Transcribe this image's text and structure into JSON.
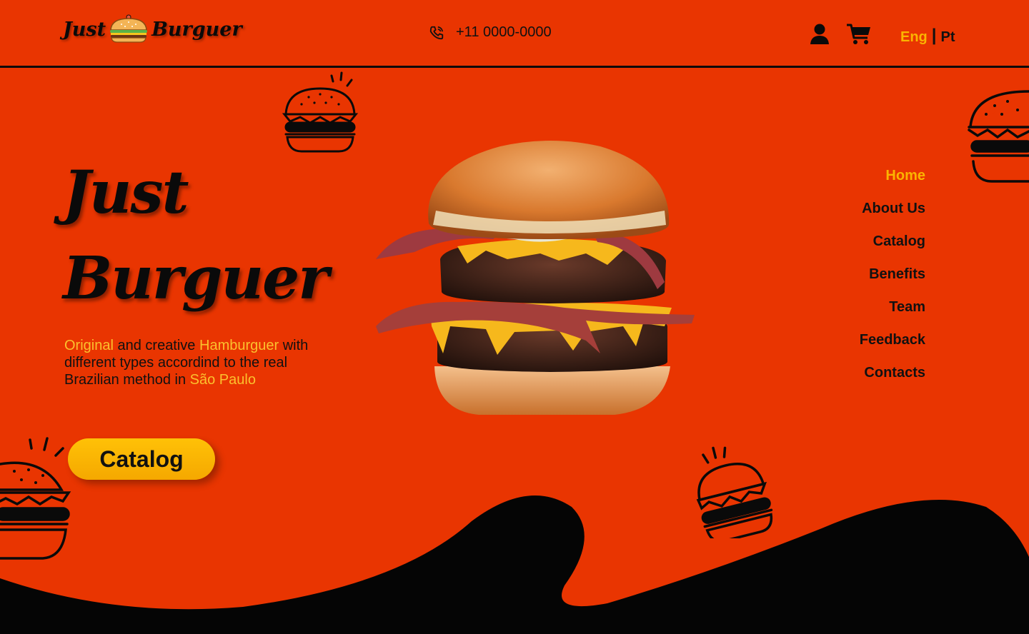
{
  "brand": {
    "logo_left": "Just",
    "logo_right": "Burguer",
    "logo_icon": "burger-icon"
  },
  "header": {
    "phone_icon": "phone-icon",
    "phone": "+11 0000-0000",
    "user_icon": "user-icon",
    "cart_icon": "cart-icon",
    "lang_active": "Eng",
    "lang_separator": "|",
    "lang_other": "Pt"
  },
  "hero": {
    "title_line1": "Just",
    "title_line2": "Burguer",
    "desc": {
      "w1": "Original",
      "t1": " and creative ",
      "w2": "Hamburguer",
      "t2": " with different types accordind to the real Brazilian method in ",
      "w3": "São Paulo"
    },
    "cta": "Catalog"
  },
  "nav": {
    "items": [
      "Home",
      "About Us",
      "Catalog",
      "Benefits",
      "Team",
      "Feedback",
      "Contacts"
    ],
    "active": "Home"
  },
  "colors": {
    "background": "#E93501",
    "accent": "#FBB400",
    "dark": "#0a0a0a"
  }
}
